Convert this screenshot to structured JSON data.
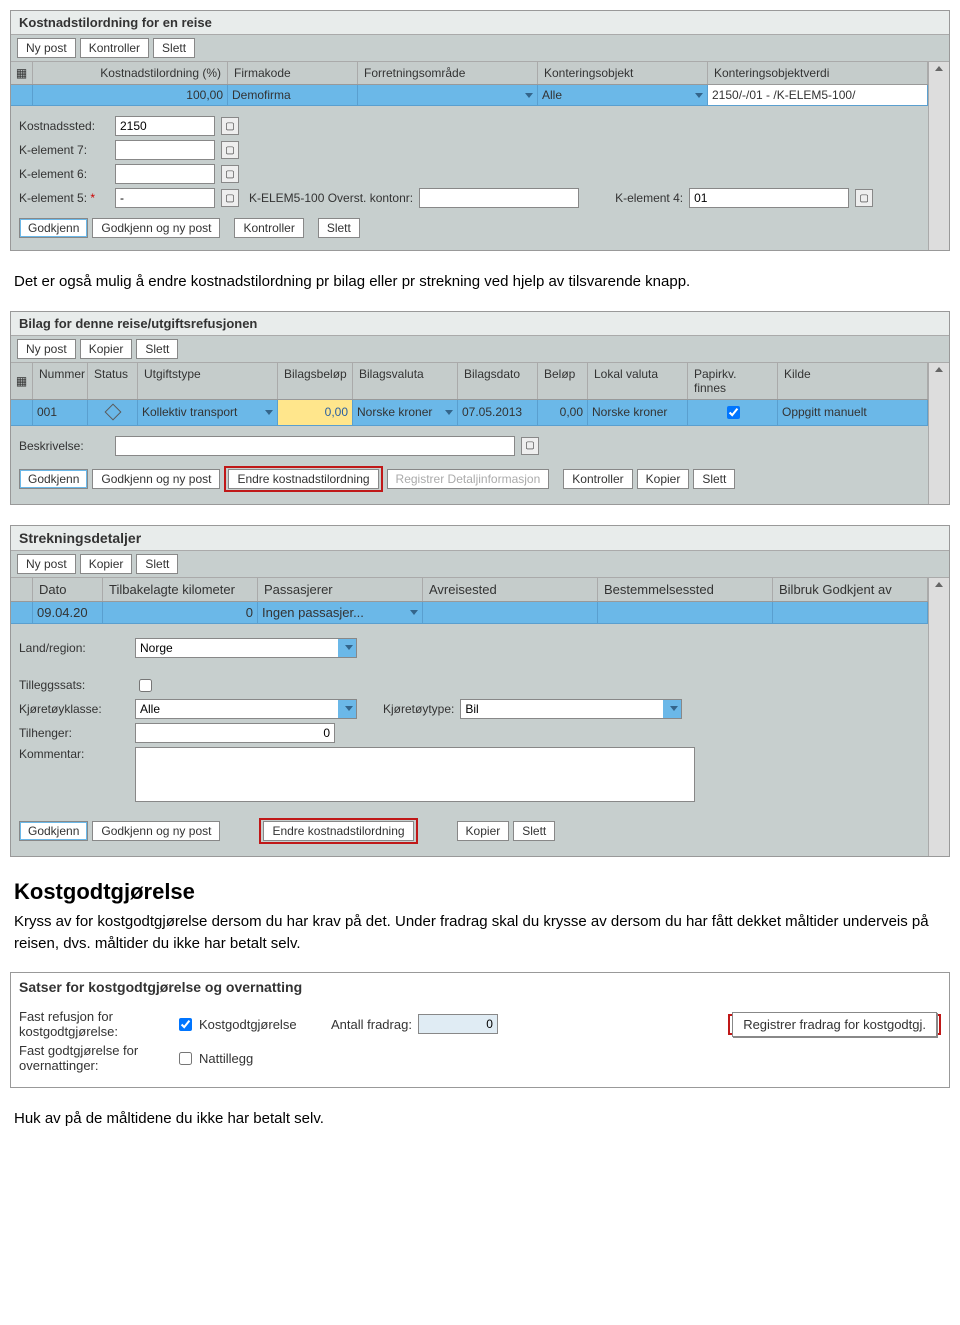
{
  "panel1": {
    "title": "Kostnadstilordning for en reise",
    "buttons": {
      "nypost": "Ny post",
      "kontroller": "Kontroller",
      "slett": "Slett"
    },
    "cols": {
      "pct": "Kostnadstilordning (%)",
      "firma": "Firmakode",
      "forr": "Forretningsområde",
      "kont": "Konteringsobjekt",
      "verdi": "Konteringsobjektverdi"
    },
    "row": {
      "pct": "100,00",
      "firma": "Demofirma",
      "kont": "Alle",
      "verdi": "2150/-/01 - /K-ELEM5-100/"
    },
    "det": {
      "kostnadssted": "Kostnadssted:",
      "kostnadssted_v": "2150",
      "kel7": "K-element 7:",
      "kel6": "K-element 6:",
      "kel5": "K-element 5:",
      "kel5mid": "K-ELEM5-100 Overst. kontonr:",
      "kel5midv": "",
      "kel4": "K-element 4:",
      "kel4_v": "01",
      "kel5_v": "-"
    },
    "bb": {
      "godkjenn": "Godkjenn",
      "gnp": "Godkjenn og ny post",
      "kontroller": "Kontroller",
      "slett": "Slett"
    }
  },
  "para1": "Det er også mulig å endre kostnadstilordning pr bilag eller pr strekning ved hjelp av tilsvarende knapp.",
  "panel2": {
    "title": "Bilag for denne reise/utgiftsrefusjonen",
    "buttons": {
      "nypost": "Ny post",
      "kopier": "Kopier",
      "slett": "Slett"
    },
    "cols": {
      "num": "Nummer",
      "stat": "Status",
      "utg": "Utgiftstype",
      "bb": "Bilagsbeløp",
      "bv": "Bilagsvaluta",
      "bd": "Bilagsdato",
      "bel": "Beløp",
      "lv": "Lokal valuta",
      "pf": "Papirkv. finnes",
      "kilde": "Kilde"
    },
    "row": {
      "num": "001",
      "utg": "Kollektiv transport",
      "bb": "0,00",
      "bv": "Norske kroner",
      "bd": "07.05.2013",
      "bel": "0,00",
      "lv": "Norske kroner",
      "kilde": "Oppgitt manuelt"
    },
    "det": {
      "besk": "Beskrivelse:"
    },
    "bb": {
      "godkjenn": "Godkjenn",
      "gnp": "Godkjenn og ny post",
      "ek": "Endre kostnadstilordning",
      "rd": "Registrer Detaljinformasjon",
      "kontroller": "Kontroller",
      "kopier": "Kopier",
      "slett": "Slett"
    }
  },
  "panel3": {
    "title": "Strekningsdetaljer",
    "buttons": {
      "nypost": "Ny post",
      "kopier": "Kopier",
      "slett": "Slett"
    },
    "cols": {
      "dato": "Dato",
      "km": "Tilbakelagte kilometer",
      "pas": "Passasjerer",
      "avr": "Avreisested",
      "best": "Bestemmelsessted",
      "bilg": "Bilbruk Godkjent av"
    },
    "row": {
      "dato": "09.04.20",
      "km": "0",
      "pas": "Ingen passasjer..."
    },
    "det": {
      "land": "Land/region:",
      "land_v": "Norge",
      "tillegg": "Tilleggssats:",
      "kklasse": "Kjøretøyklasse:",
      "kklasse_v": "Alle",
      "ktype": "Kjøretøytype:",
      "ktype_v": "Bil",
      "tilhenger": "Tilhenger:",
      "tilhenger_v": "0",
      "kommentar": "Kommentar:"
    },
    "bb": {
      "godkjenn": "Godkjenn",
      "gnp": "Godkjenn og ny post",
      "ek": "Endre kostnadstilordning",
      "kopier": "Kopier",
      "slett": "Slett"
    }
  },
  "h_kg": "Kostgodtgjørelse",
  "para_kg": "Kryss av for kostgodtgjørelse dersom du har krav på det. Under fradrag skal du krysse av dersom du har fått dekket måltider underveis på reisen, dvs. måltider du ikke har betalt selv.",
  "panel4": {
    "title": "Satser for kostgodtgjørelse og overnatting",
    "r1l": "Fast refusjon for kostgodtgjørelse:",
    "r1c": "Kostgodtgjørelse",
    "r1a": "Antall fradrag:",
    "r1av": "0",
    "r1btn": "Registrer fradrag for kostgodtgj.",
    "r2l": "Fast godtgjørelse for overnattinger:",
    "r2c": "Nattillegg"
  },
  "para_last": "Huk av på de måltidene du ikke har betalt selv."
}
